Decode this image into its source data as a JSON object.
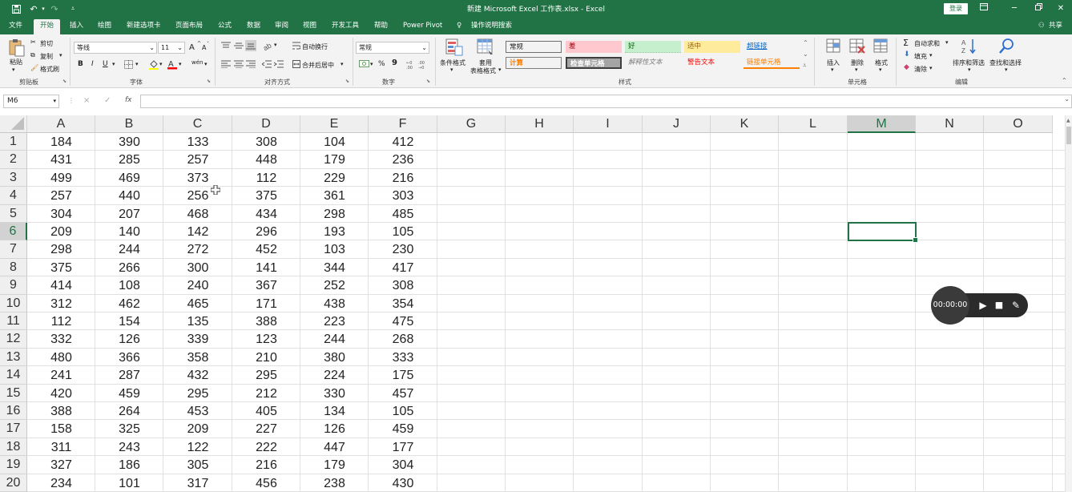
{
  "window": {
    "title": "新建 Microsoft Excel 工作表.xlsx  -  Excel",
    "login_label": "登录"
  },
  "qat": {
    "save_icon": "save-icon",
    "undo_icon": "undo-icon",
    "redo_icon": "redo-icon",
    "customize_icon": "customize-qat-icon"
  },
  "tabs": [
    "文件",
    "开始",
    "插入",
    "绘图",
    "新建选项卡",
    "页面布局",
    "公式",
    "数据",
    "审阅",
    "视图",
    "开发工具",
    "帮助",
    "Power Pivot"
  ],
  "active_tab": "开始",
  "tell_me": "操作说明搜索",
  "share_label": "共享",
  "ribbon": {
    "clipboard": {
      "paste": "粘贴",
      "cut": "剪切",
      "copy": "复制",
      "format_painter": "格式刷",
      "group": "剪贴板"
    },
    "font": {
      "name": "等线",
      "size": "11",
      "bold": "B",
      "italic": "I",
      "underline": "U",
      "grow": "A",
      "shrink": "A",
      "phonetic": "wén",
      "group": "字体"
    },
    "alignment": {
      "wrap": "自动换行",
      "merge": "合并后居中",
      "group": "对齐方式"
    },
    "number": {
      "format": "常规",
      "percent": "%",
      "comma": "9",
      "group": "数字"
    },
    "styles": {
      "conditional": "条件格式",
      "table": "套用",
      "table2": "表格格式",
      "cells": [
        {
          "label": "常规",
          "bg": "#ffffff",
          "fg": "#222222"
        },
        {
          "label": "差",
          "bg": "#ffc7ce",
          "fg": "#9c0006"
        },
        {
          "label": "好",
          "bg": "#c6efce",
          "fg": "#006100"
        },
        {
          "label": "适中",
          "bg": "#ffeb9c",
          "fg": "#9c5700"
        },
        {
          "label": "超链接",
          "bg": "#ffffff",
          "fg": "#0563c1"
        },
        {
          "label": "计算",
          "bg": "#f2f2f2",
          "fg": "#fa7d00"
        },
        {
          "label": "检查单元格",
          "bg": "#a5a5a5",
          "fg": "#ffffff"
        },
        {
          "label": "解释性文本",
          "bg": "#ffffff",
          "fg": "#7f7f7f"
        },
        {
          "label": "警告文本",
          "bg": "#ffffff",
          "fg": "#ff0000"
        },
        {
          "label": "链接单元格",
          "bg": "#ffffff",
          "fg": "#fa7d00"
        }
      ],
      "group": "样式"
    },
    "cells_group": {
      "insert": "插入",
      "delete": "删除",
      "format": "格式",
      "group": "单元格"
    },
    "editing": {
      "autosum": "自动求和",
      "fill": "填充",
      "clear": "清除",
      "sort": "排序和筛选",
      "find": "查找和选择",
      "group": "编辑"
    }
  },
  "formula_bar": {
    "name_box": "M6",
    "cancel": "×",
    "enter": "✓",
    "fx": "fx",
    "content": ""
  },
  "sheet": {
    "columns": [
      "A",
      "B",
      "C",
      "D",
      "E",
      "F",
      "G",
      "H",
      "I",
      "J",
      "K",
      "L",
      "M",
      "N",
      "O"
    ],
    "selected_column": "M",
    "selected_row": 6,
    "rows": [
      [
        184,
        390,
        133,
        308,
        104,
        412
      ],
      [
        431,
        285,
        257,
        448,
        179,
        236
      ],
      [
        499,
        469,
        373,
        112,
        229,
        216
      ],
      [
        257,
        440,
        256,
        375,
        361,
        303
      ],
      [
        304,
        207,
        468,
        434,
        298,
        485
      ],
      [
        209,
        140,
        142,
        296,
        193,
        105
      ],
      [
        298,
        244,
        272,
        452,
        103,
        230
      ],
      [
        375,
        266,
        300,
        141,
        344,
        417
      ],
      [
        414,
        108,
        240,
        367,
        252,
        308
      ],
      [
        312,
        462,
        465,
        171,
        438,
        354
      ],
      [
        112,
        154,
        135,
        388,
        223,
        475
      ],
      [
        332,
        126,
        339,
        123,
        244,
        268
      ],
      [
        480,
        366,
        358,
        210,
        380,
        333
      ],
      [
        241,
        287,
        432,
        295,
        224,
        175
      ],
      [
        420,
        459,
        295,
        212,
        330,
        457
      ],
      [
        388,
        264,
        453,
        405,
        134,
        105
      ],
      [
        158,
        325,
        209,
        227,
        126,
        459
      ],
      [
        311,
        243,
        122,
        222,
        447,
        177
      ],
      [
        327,
        186,
        305,
        216,
        179,
        304
      ],
      [
        234,
        101,
        317,
        456,
        238,
        430
      ]
    ]
  },
  "recorder": {
    "time": "00:00:00"
  }
}
